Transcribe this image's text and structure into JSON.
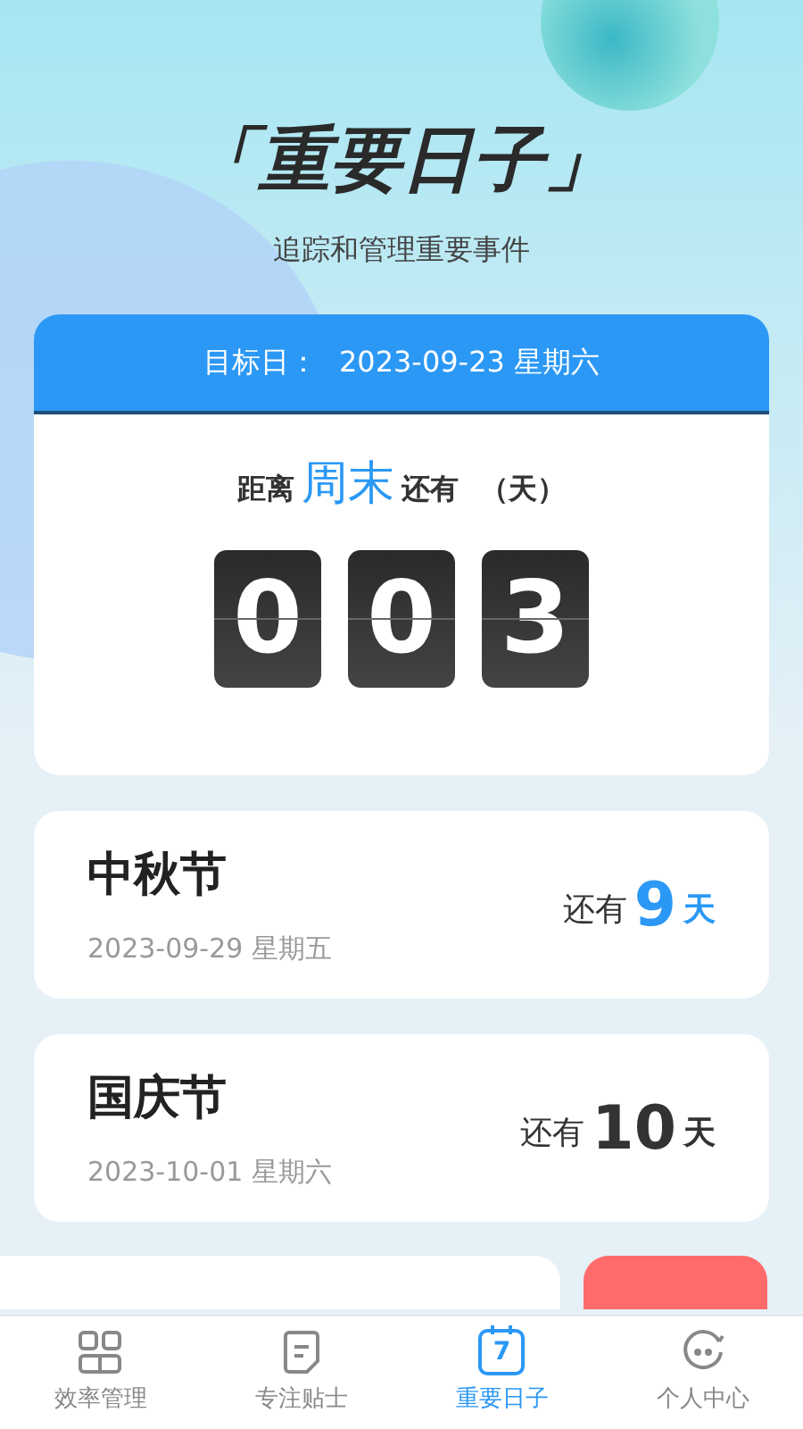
{
  "header": {
    "title": "「重要日子」",
    "subtitle": "追踪和管理重要事件"
  },
  "countdown": {
    "target_label": "目标日：",
    "target_date": "2023-09-23 星期六",
    "prefix": "距离",
    "event": "周末",
    "suffix": "还有",
    "unit": "（天）",
    "digits": [
      "0",
      "0",
      "3"
    ]
  },
  "events": [
    {
      "name": "中秋节",
      "date": "2023-09-29 星期五",
      "prefix": "还有",
      "count": "9",
      "unit": "天",
      "color": "#2b98f5"
    },
    {
      "name": "国庆节",
      "date": "2023-10-01 星期六",
      "prefix": "还有",
      "count": "10",
      "unit": "天",
      "color": "#333333"
    }
  ],
  "tabs": [
    {
      "label": "效率管理",
      "kind": "grid",
      "selected": false
    },
    {
      "label": "专注贴士",
      "kind": "note",
      "selected": false
    },
    {
      "label": "重要日子",
      "kind": "calendar",
      "icon_text": "7",
      "selected": true
    },
    {
      "label": "个人中心",
      "kind": "face",
      "selected": false
    }
  ]
}
